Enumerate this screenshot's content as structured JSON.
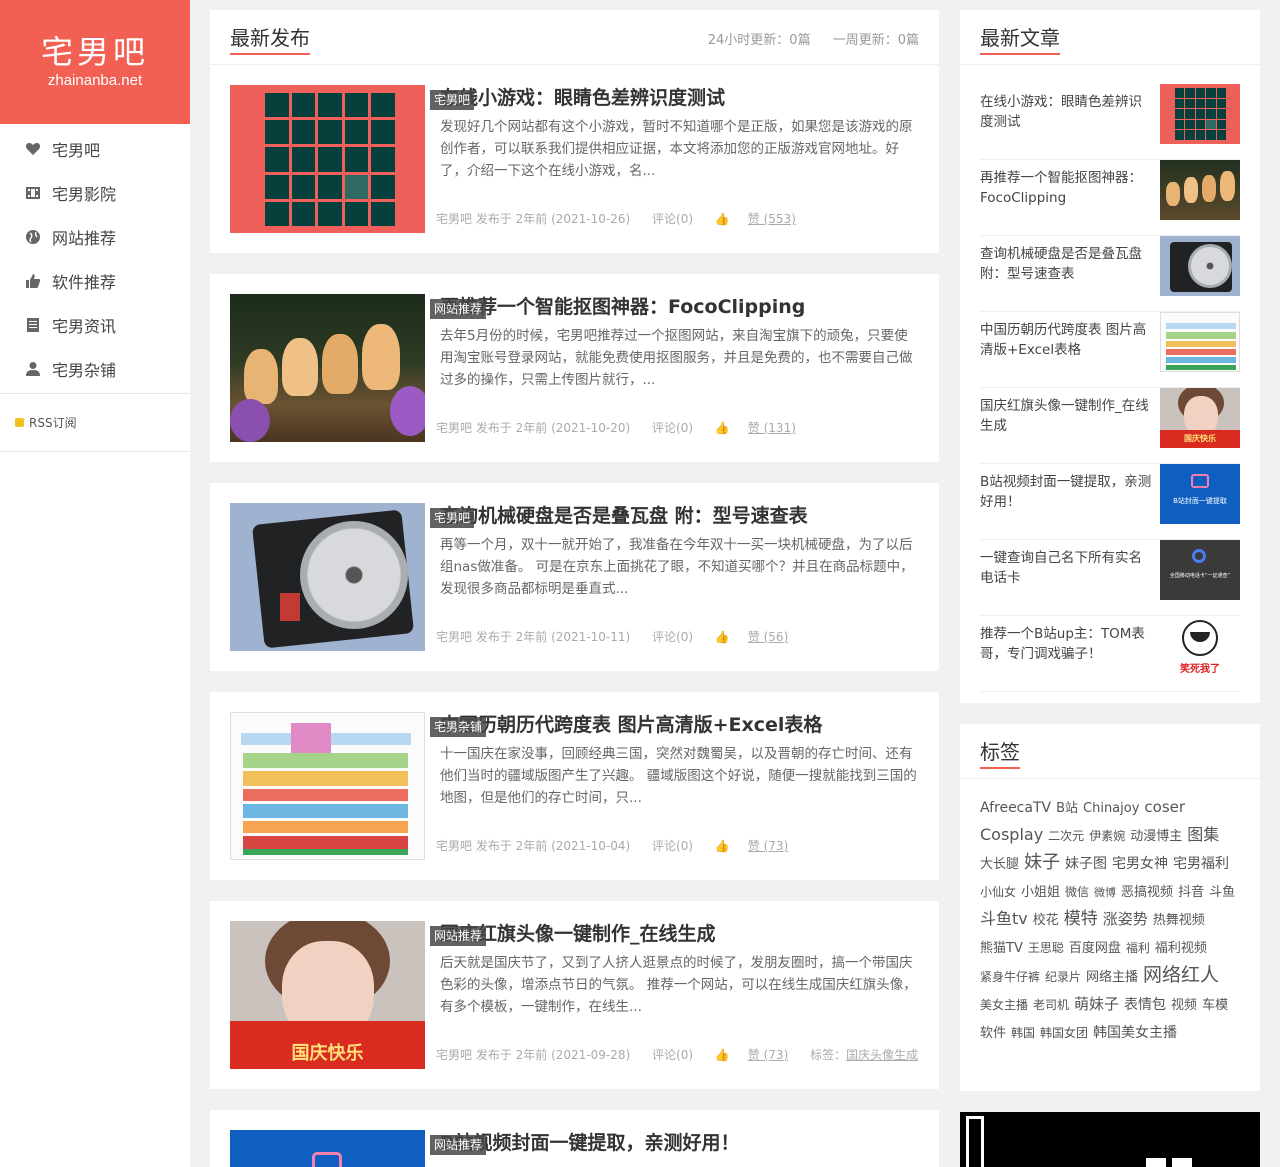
{
  "site": {
    "name": "宅男吧",
    "domain": "zhainanba.net",
    "accent": "#f25f53"
  },
  "nav": [
    {
      "label": "宅男吧",
      "icon": "heart-icon"
    },
    {
      "label": "宅男影院",
      "icon": "film-icon"
    },
    {
      "label": "网站推荐",
      "icon": "globe-icon"
    },
    {
      "label": "软件推荐",
      "icon": "thumbs-up-icon"
    },
    {
      "label": "宅男资讯",
      "icon": "news-icon"
    },
    {
      "label": "宅男杂铺",
      "icon": "user-icon"
    }
  ],
  "rss": "RSS订阅",
  "main": {
    "title": "最新发布",
    "stat_24h": "24小时更新：0篇",
    "stat_week": "一周更新：0篇",
    "posts": [
      {
        "category": "宅男吧",
        "title": "在线小游戏：眼睛色差辨识度测试",
        "excerpt": "发现好几个网站都有这个小游戏，暂时不知道哪个是正版，如果您是该游戏的原创作者，可以联系我们提供相应证据，本文将添加您的正版游戏官网地址。好了，介绍一下这个在线小游戏，名...",
        "meta": "宅男吧 发布于 2年前 (2021-10-26)",
        "comments": "评论(0)",
        "likes": "赞 (553)",
        "tags_label": "",
        "tags": ""
      },
      {
        "category": "网站推荐",
        "title": "再推荐一个智能抠图神器：FocoClipping",
        "excerpt": "去年5月份的时候，宅男吧推荐过一个抠图网站，来自淘宝旗下的顽兔，只要使用淘宝账号登录网站，就能免费使用抠图服务，并且是免费的，也不需要自己做过多的操作，只需上传图片就行，...",
        "meta": "宅男吧 发布于 2年前 (2021-10-20)",
        "comments": "评论(0)",
        "likes": "赞 (131)",
        "tags_label": "",
        "tags": ""
      },
      {
        "category": "宅男吧",
        "title": "查询机械硬盘是否是叠瓦盘 附：型号速查表",
        "excerpt": "再等一个月，双十一就开始了，我准备在今年双十一买一块机械硬盘，为了以后组nas做准备。 可是在京东上面挑花了眼，不知道买哪个？并且在商品标题中，发现很多商品都标明是垂直式...",
        "meta": "宅男吧 发布于 2年前 (2021-10-11)",
        "comments": "评论(0)",
        "likes": "赞 (56)",
        "tags_label": "",
        "tags": ""
      },
      {
        "category": "宅男杂铺",
        "title": "中国历朝历代跨度表 图片高清版+Excel表格",
        "excerpt": "十一国庆在家没事，回顾经典三国，突然对魏蜀吴，以及晋朝的存亡时间、还有他们当时的疆域版图产生了兴趣。 疆域版图这个好说，随便一搜就能找到三国的地图，但是他们的存亡时间，只...",
        "meta": "宅男吧 发布于 2年前 (2021-10-04)",
        "comments": "评论(0)",
        "likes": "赞 (73)",
        "tags_label": "",
        "tags": ""
      },
      {
        "category": "网站推荐",
        "title": "国庆红旗头像一键制作_在线生成",
        "excerpt": "后天就是国庆节了，又到了人挤人逛景点的时候了，发朋友圈时，搞一个带国庆色彩的头像，增添点节日的气氛。 推荐一个网站，可以在线生成国庆红旗头像，有多个模板，一键制作，在线生...",
        "meta": "宅男吧 发布于 2年前 (2021-09-28)",
        "comments": "评论(0)",
        "likes": "赞 (73)",
        "tags_label": "标签：",
        "tags": "国庆头像生成"
      },
      {
        "category": "网站推荐",
        "title": "B站视频封面一键提取，亲测好用！",
        "excerpt": "",
        "meta": "",
        "comments": "",
        "likes": "",
        "tags_label": "",
        "tags": ""
      }
    ]
  },
  "latest": {
    "title": "最新文章",
    "items": [
      "在线小游戏：眼睛色差辨识度测试",
      "再推荐一个智能抠图神器：FocoClipping",
      "查询机械硬盘是否是叠瓦盘 附：型号速查表",
      "中国历朝历代跨度表 图片高清版+Excel表格",
      "国庆红旗头像一键制作_在线生成",
      "B站视频封面一键提取，亲测好用！",
      "一键查询自己名下所有实名电话卡",
      "推荐一个B站up主：TOM表哥，专门调戏骗子！"
    ],
    "thumb_texts": {
      "flag": "国庆快乐",
      "bili": "B站封面一键提取",
      "phone": "全国移动电话卡“一证通查”",
      "meme": "笑死我了"
    }
  },
  "tags": {
    "title": "标签",
    "items": [
      {
        "label": "AfreecaTV",
        "size": 14
      },
      {
        "label": "B站",
        "size": 13
      },
      {
        "label": "Chinajoy",
        "size": 13
      },
      {
        "label": "coser",
        "size": 15
      },
      {
        "label": "Cosplay",
        "size": 16
      },
      {
        "label": "二次元",
        "size": 12
      },
      {
        "label": "伊素婉",
        "size": 12
      },
      {
        "label": "动漫博主",
        "size": 13
      },
      {
        "label": "图集",
        "size": 16
      },
      {
        "label": "大长腿",
        "size": 13
      },
      {
        "label": "妹子",
        "size": 18
      },
      {
        "label": "妹子图",
        "size": 14
      },
      {
        "label": "宅男女神",
        "size": 14
      },
      {
        "label": "宅男福利",
        "size": 14
      },
      {
        "label": "小仙女",
        "size": 12
      },
      {
        "label": "小姐姐",
        "size": 13
      },
      {
        "label": "微信",
        "size": 12
      },
      {
        "label": "微博",
        "size": 11
      },
      {
        "label": "恶搞视频",
        "size": 13
      },
      {
        "label": "抖音",
        "size": 13
      },
      {
        "label": "斗鱼",
        "size": 13
      },
      {
        "label": "斗鱼tv",
        "size": 16
      },
      {
        "label": "校花",
        "size": 13
      },
      {
        "label": "模特",
        "size": 17
      },
      {
        "label": "涨姿势",
        "size": 15
      },
      {
        "label": "热舞视频",
        "size": 13
      },
      {
        "label": "熊猫TV",
        "size": 13
      },
      {
        "label": "王思聪",
        "size": 12
      },
      {
        "label": "百度网盘",
        "size": 13
      },
      {
        "label": "福利",
        "size": 12
      },
      {
        "label": "福利视频",
        "size": 13
      },
      {
        "label": "紧身牛仔裤",
        "size": 12
      },
      {
        "label": "纪录片",
        "size": 12
      },
      {
        "label": "网络主播",
        "size": 13
      },
      {
        "label": "网络红人",
        "size": 19
      },
      {
        "label": "美女主播",
        "size": 12
      },
      {
        "label": "老司机",
        "size": 12
      },
      {
        "label": "萌妹子",
        "size": 15
      },
      {
        "label": "表情包",
        "size": 14
      },
      {
        "label": "视频",
        "size": 13
      },
      {
        "label": "车模",
        "size": 13
      },
      {
        "label": "软件",
        "size": 13
      },
      {
        "label": "韩国",
        "size": 12
      },
      {
        "label": "韩国女团",
        "size": 12
      },
      {
        "label": "韩国美女主播",
        "size": 14
      }
    ]
  }
}
